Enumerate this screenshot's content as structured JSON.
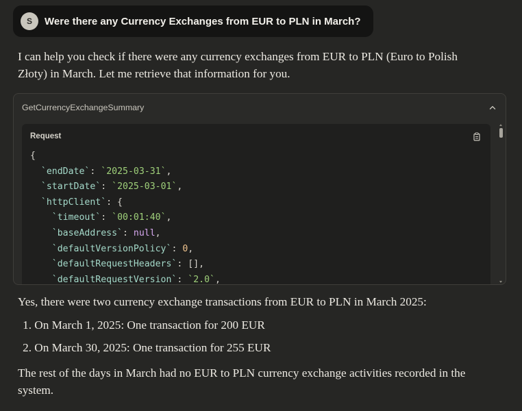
{
  "user": {
    "avatar_initial": "S",
    "message": "Were there any Currency Exchanges from EUR to PLN in March?"
  },
  "assistant": {
    "intro_line1": "I can help you check if there were any currency exchanges from EUR to PLN (Euro to Polish",
    "intro_line2": "Złoty) in March. Let me retrieve that information for you.",
    "result": "Yes, there were two currency exchange transactions from EUR to PLN in March 2025:",
    "list": [
      {
        "marker": "1.",
        "text": "On March 1, 2025: One transaction for 200 EUR"
      },
      {
        "marker": "2.",
        "text": "On March 30, 2025: One transaction for 255 EUR"
      }
    ],
    "rest_line1": "The rest of the days in March had no EUR to PLN currency exchange activities recorded in the",
    "rest_line2": "system."
  },
  "tool_call": {
    "name": "GetCurrencyExchangeSummary",
    "request_label": "Request",
    "code": {
      "open_brace": "{",
      "end_date_key": "`endDate`",
      "end_date_val": "`2025-03-31`",
      "start_date_key": "`startDate`",
      "start_date_val": "`2025-03-01`",
      "http_client_key": "`httpClient`",
      "timeout_key": "`timeout`",
      "timeout_val": "`00:01:40`",
      "base_address_key": "`baseAddress`",
      "base_address_val": "null",
      "default_version_policy_key": "`defaultVersionPolicy`",
      "default_version_policy_val": "0",
      "default_request_headers_key": "`defaultRequestHeaders`",
      "default_request_headers_val": "[]",
      "default_request_version_key": "`defaultRequestVersion`",
      "default_request_version_val": "`2.0`"
    }
  },
  "icons": {
    "collapse": "chevron-up-icon",
    "copy": "copy-icon"
  }
}
